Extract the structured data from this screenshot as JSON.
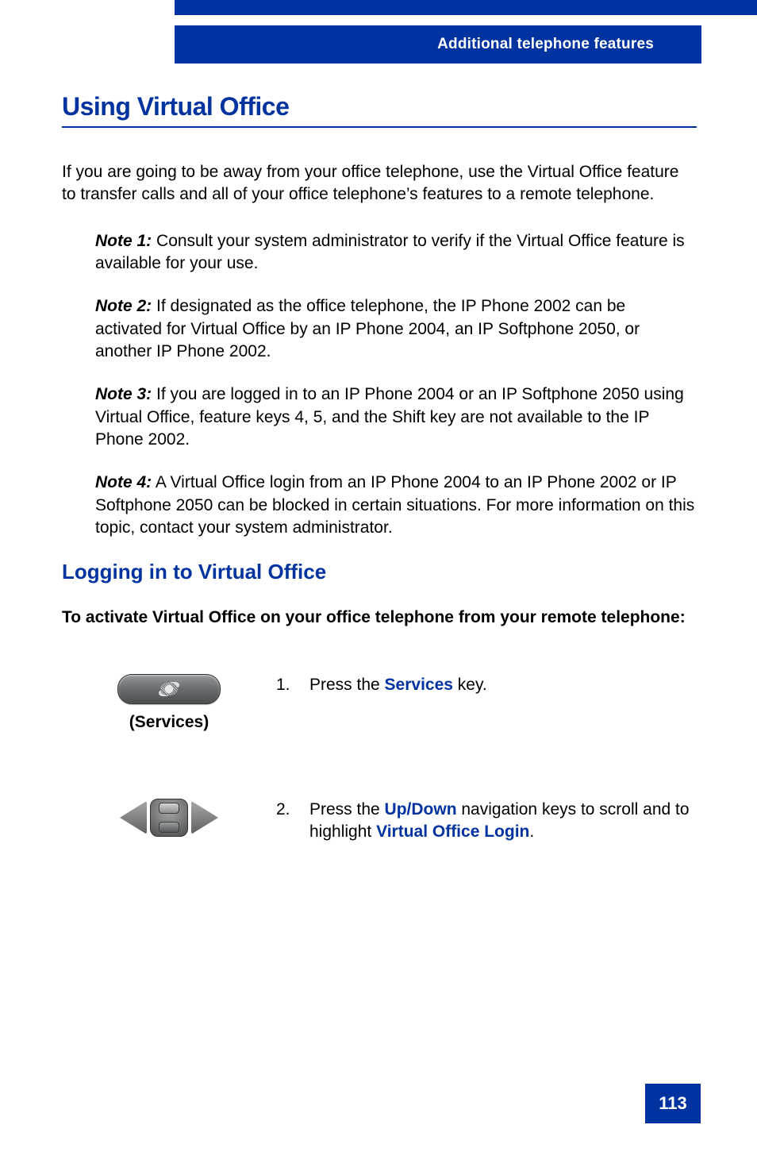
{
  "header": {
    "section_title": "Additional telephone features"
  },
  "h1": "Using Virtual Office",
  "intro": "If you are going to be away from your office telephone, use the Virtual Office feature to transfer calls and all of your office telephone’s features to a remote telephone.",
  "notes": [
    {
      "label": "Note 1:",
      "text": " Consult your system administrator to verify if the Virtual Office feature is available for your use."
    },
    {
      "label": "Note 2:",
      "text": " If designated as the office telephone, the IP Phone 2002 can be activated for Virtual Office by an IP Phone 2004, an IP Softphone 2050, or another IP Phone 2002."
    },
    {
      "label": "Note 3:",
      "text": " If you are logged in to an IP Phone 2004 or an IP Softphone 2050 using Virtual Office, feature keys 4, 5, and the Shift key are not available to the IP Phone 2002."
    },
    {
      "label": "Note 4:",
      "text": " A Virtual Office login from an IP Phone 2004 to an IP Phone 2002 or IP Softphone 2050 can be blocked in certain situations. For more information on this topic, contact your system administrator."
    }
  ],
  "h2": "Logging in to Virtual Office",
  "lead": "To activate Virtual Office on your office telephone from your remote telephone:",
  "steps": {
    "s1": {
      "num": "1.",
      "pre": "Press the ",
      "kw": "Services",
      "post": " key.",
      "caption": "(Services)"
    },
    "s2": {
      "num": "2.",
      "pre": "Press the ",
      "kw1": "Up/Down",
      "mid": " navigation keys to scroll and to highlight ",
      "kw2": "Virtual Office Login",
      "post": "."
    }
  },
  "page_number": "113"
}
